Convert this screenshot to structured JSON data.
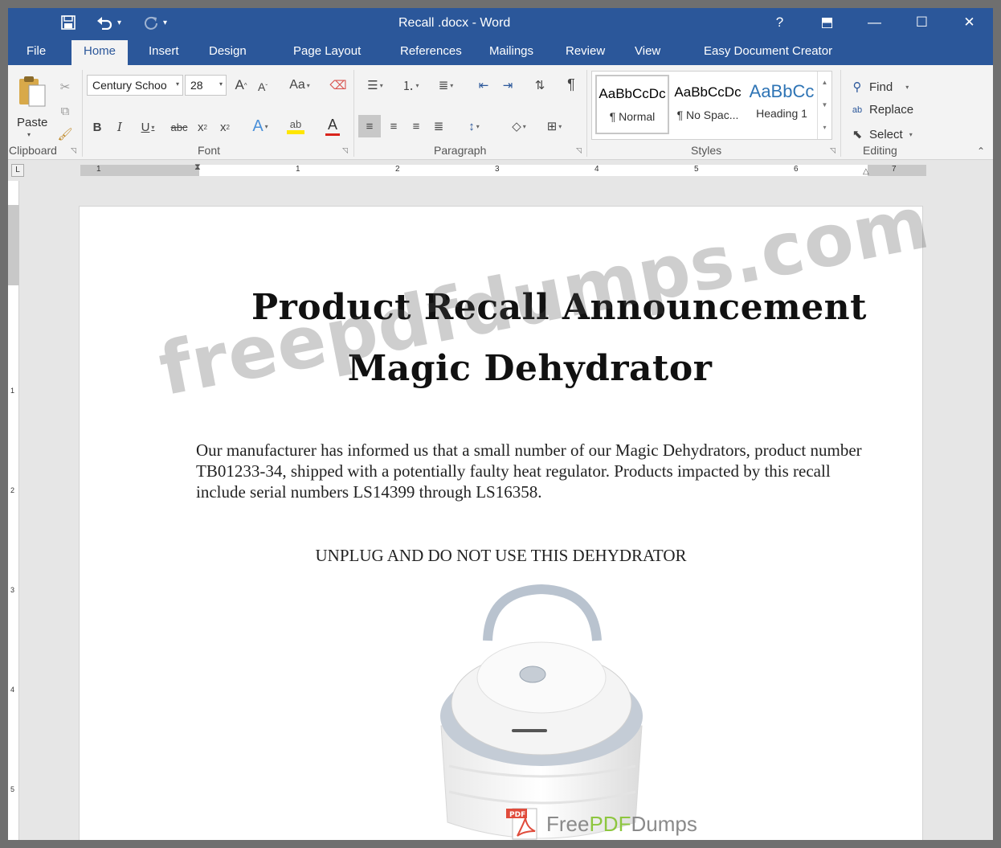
{
  "window": {
    "title": "Recall .docx  - Word",
    "help": "?",
    "controls": {
      "ribbon_display": "⬒",
      "minimize": "—",
      "maximize": "☐",
      "close": "✕"
    }
  },
  "qat": {
    "save_icon": "save-icon",
    "undo_icon": "undo-icon",
    "redo_icon": "redo-icon",
    "customize": "▾"
  },
  "tabs": [
    {
      "label": "File"
    },
    {
      "label": "Home"
    },
    {
      "label": "Insert"
    },
    {
      "label": "Design"
    },
    {
      "label": "Page Layout"
    },
    {
      "label": "References"
    },
    {
      "label": "Mailings"
    },
    {
      "label": "Review"
    },
    {
      "label": "View"
    },
    {
      "label": "Easy Document Creator"
    }
  ],
  "ribbon": {
    "clipboard": {
      "paste_label": "Paste",
      "group_label": "Clipboard"
    },
    "font": {
      "font_name": "Century Schoo",
      "font_size": "28",
      "grow": "A",
      "shrink": "A",
      "change_case": "Aa",
      "bold": "B",
      "italic": "I",
      "underline": "U",
      "strike": "abc",
      "subscript": "x",
      "superscript": "x",
      "text_effects": "A",
      "highlight": "ab",
      "font_color": "A",
      "group_label": "Font"
    },
    "paragraph": {
      "group_label": "Paragraph",
      "pilcrow": "¶"
    },
    "styles": {
      "group_label": "Styles",
      "items": [
        {
          "preview": "AaBbCcDc",
          "name": "¶ Normal"
        },
        {
          "preview": "AaBbCcDc",
          "name": "¶ No Spac..."
        },
        {
          "preview": "AaBbCc",
          "name": "Heading 1"
        }
      ]
    },
    "editing": {
      "group_label": "Editing",
      "find": "Find",
      "replace": "Replace",
      "select": "Select"
    }
  },
  "ruler": {
    "marks": [
      "1",
      "1",
      "2",
      "3",
      "4",
      "5",
      "6",
      "7"
    ],
    "vmarks": [
      "1",
      "2",
      "3",
      "4",
      "5"
    ]
  },
  "document": {
    "title_line1": "Product Recall Announcement",
    "title_line2": "Magic Dehydrator",
    "paragraph": "Our manufacturer has informed us that a small number of our Magic Dehydrators, product number TB01233-34, shipped with a potentially faulty heat regulator. Products impacted by this recall include serial numbers LS14399 through LS16358.",
    "warning": "UNPLUG AND DO NOT USE THIS DEHYDRATOR"
  },
  "overlay": {
    "watermark": "freepdfdumps.com",
    "brand_a": "Free",
    "brand_b": "PDF",
    "brand_c": "Dumps",
    "pdf_label": "PDF"
  },
  "colors": {
    "accent": "#2b579a",
    "brand_green": "#8dc63f"
  }
}
